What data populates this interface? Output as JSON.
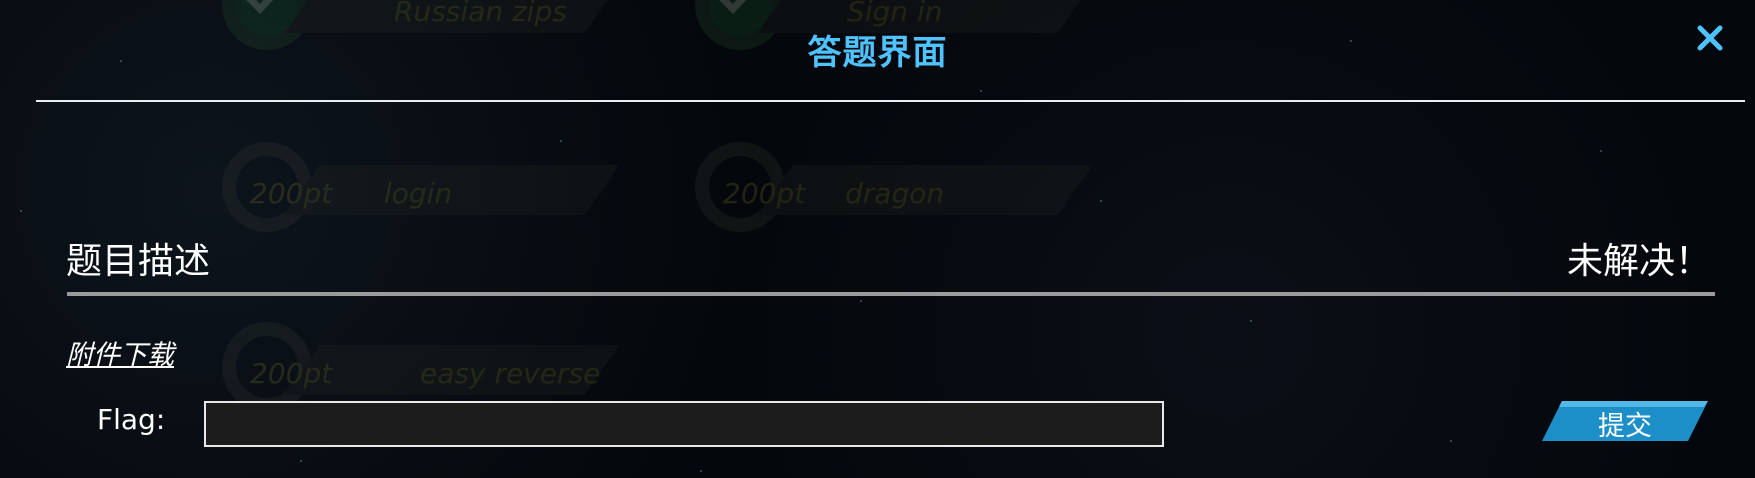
{
  "modal": {
    "title": "答题界面",
    "description_label": "题目描述",
    "status": "未解决！",
    "attachment_link": "附件下载",
    "flag_label": "Flag:",
    "flag_value": "",
    "submit_label": "提交"
  },
  "background_challenges": [
    {
      "name": "Russian zips",
      "points": "",
      "solved": true
    },
    {
      "name": "Sign in",
      "points": "",
      "solved": true
    },
    {
      "name": "login",
      "points": "200pt",
      "solved": false
    },
    {
      "name": "dragon",
      "points": "200pt",
      "solved": false
    },
    {
      "name": "easy reverse",
      "points": "200pt",
      "solved": false
    }
  ],
  "colors": {
    "title": "#4fc3ff",
    "submit": "#1c8fc8",
    "close_icon": "#4fc3ff",
    "divider": "#9b9b9b"
  },
  "icons": {
    "close": "close-icon",
    "check": "check-icon",
    "gear": "gear-badge-icon"
  }
}
